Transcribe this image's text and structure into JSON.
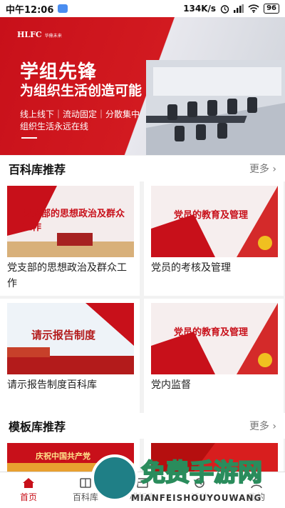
{
  "statusbar": {
    "time": "中午12:06",
    "speed": "134K/s",
    "battery": "96"
  },
  "banner": {
    "logo": "HLFC",
    "logo_sub": "华鼎未来",
    "title": "学组先锋",
    "subtitle": "为组织生活创造可能",
    "line1": "线上线下｜流动固定｜分散集中",
    "line2": "组织生活永远在线"
  },
  "encyclopedia": {
    "header": "百科库推荐",
    "more": "更多 ›",
    "cards": [
      {
        "caption": "党支部的思想政治及群众工作",
        "thumb_text": "党支部的思想政治及群众工作"
      },
      {
        "caption": "党员的考核及管理",
        "thumb_text": "党员的教育及管理"
      },
      {
        "caption": "请示报告制度百科库",
        "thumb_text": "请示报告制度"
      },
      {
        "caption": "党内监督",
        "thumb_text": "党员的教育及管理"
      }
    ]
  },
  "templates": {
    "header": "模板库推荐",
    "more": "更多 ›",
    "thumb_text": "庆祝中国共产党"
  },
  "tabs": [
    {
      "label": "首页",
      "icon": "home-icon",
      "active": true
    },
    {
      "label": "百科库",
      "icon": "book-icon",
      "active": false
    },
    {
      "label": "模板库",
      "icon": "template-icon",
      "active": false
    },
    {
      "label": "活动",
      "icon": "activity-icon",
      "active": false
    },
    {
      "label": "我的",
      "icon": "user-icon",
      "active": false
    }
  ],
  "watermark": {
    "big": "免费手游网",
    "small": "MIANFEISHOUYOUWANG"
  },
  "colors": {
    "brand_red": "#c8101a",
    "page_bg": "#f2f2f2"
  }
}
